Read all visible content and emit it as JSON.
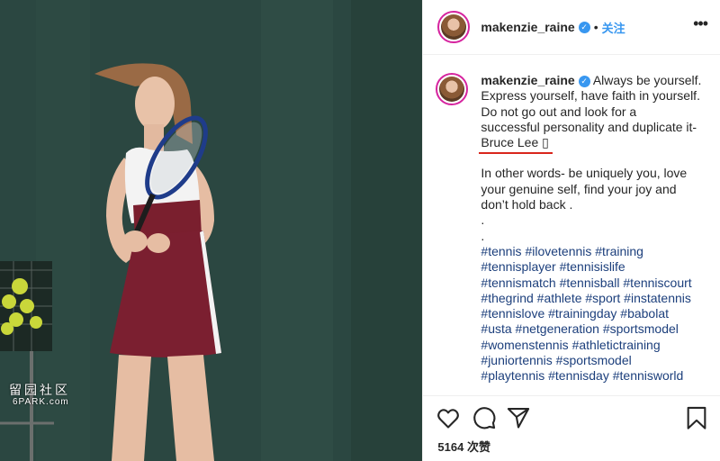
{
  "post": {
    "username": "makenzie_raine",
    "follow_label": "关注",
    "dot": "•",
    "caption_quote_lines": [
      "Always be yourself.",
      "Express yourself, have faith in yourself.",
      "Do not go out and look for a",
      "successful personality and duplicate it-"
    ],
    "caption_attribution": "Bruce Lee",
    "caption_emoji": "▯",
    "caption_paragraph2": [
      "In other words- be uniquely you, love",
      "your genuine self, find your joy and",
      "don’t hold back ."
    ],
    "separator_dots": [
      ".",
      "."
    ],
    "hashtag_lines": [
      "#tennis #ilovetennis #training",
      "#tennisplayer #tennisislife",
      "#tennismatch #tennisball #tenniscourt",
      "#thegrind #athlete #sport #instatennis",
      "#tennislove #trainingday #babolat",
      "#usta #netgeneration #sportsmodel",
      "#womenstennis #athletictraining",
      "#juniortennis #sportsmodel",
      "#playtennis #tennisday #tennisworld"
    ],
    "likes": "5164 次赞",
    "watermark_line1": "留园社区",
    "watermark_line2": "6PARK.com"
  },
  "icons": {
    "verified": "verified-badge-icon",
    "more": "more-options-icon",
    "like": "heart-icon",
    "comment": "comment-bubble-icon",
    "share": "paper-plane-icon",
    "save": "bookmark-icon"
  },
  "colors": {
    "link_blue": "#3897f0",
    "hashtag": "#1c3f7c",
    "underline_red": "#d9261c",
    "story_ring": "#d6249f"
  }
}
